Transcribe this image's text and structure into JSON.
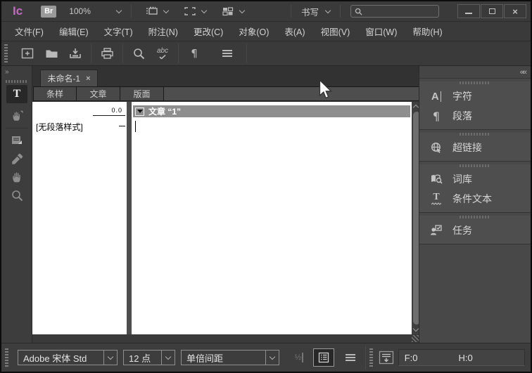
{
  "titlebar": {
    "logo": "Ic",
    "bridge": "Br",
    "zoom_level": "100%",
    "workspace": "书写",
    "search_value": ""
  },
  "menubar": {
    "items": [
      {
        "label": "文件(F)"
      },
      {
        "label": "编辑(E)"
      },
      {
        "label": "文字(T)"
      },
      {
        "label": "附注(N)"
      },
      {
        "label": "更改(C)"
      },
      {
        "label": "对象(O)"
      },
      {
        "label": "表(A)"
      },
      {
        "label": "视图(V)"
      },
      {
        "label": "窗口(W)"
      },
      {
        "label": "帮助(H)"
      }
    ]
  },
  "document": {
    "tab_title": "未命名-1",
    "tab_close": "×",
    "view_tabs": [
      {
        "label": "条样"
      },
      {
        "label": "文章"
      },
      {
        "label": "版面"
      }
    ],
    "active_view_tab": "条样",
    "galley": {
      "ruler_value": "0.0",
      "paragraph_style": "[无段落样式]",
      "story_header": "文章 “1”"
    }
  },
  "right_panel": {
    "groups": [
      {
        "items": [
          {
            "icon": "character-icon",
            "label": "字符"
          },
          {
            "icon": "paragraph-icon",
            "label": "段落"
          }
        ]
      },
      {
        "items": [
          {
            "icon": "hyperlinks-icon",
            "label": "超链接"
          }
        ]
      },
      {
        "items": [
          {
            "icon": "thesaurus-icon",
            "label": "词库"
          },
          {
            "icon": "conditional-text-icon",
            "label": "条件文本"
          }
        ]
      },
      {
        "items": [
          {
            "icon": "assignments-icon",
            "label": "任务"
          }
        ]
      }
    ]
  },
  "statusbar": {
    "font_family": "Adobe 宋体 Std",
    "font_size": "12 点",
    "line_spacing": "单倍间距",
    "copyfit_f": "F:0",
    "copyfit_h": "H:0"
  },
  "colors": {
    "logo_magenta": "#c468c4",
    "ui_dark": "#3a3a3a",
    "panel_gray": "#4e4e4e",
    "story_header_bg": "#8e8e8e",
    "galley_bg": "#ffffff"
  }
}
